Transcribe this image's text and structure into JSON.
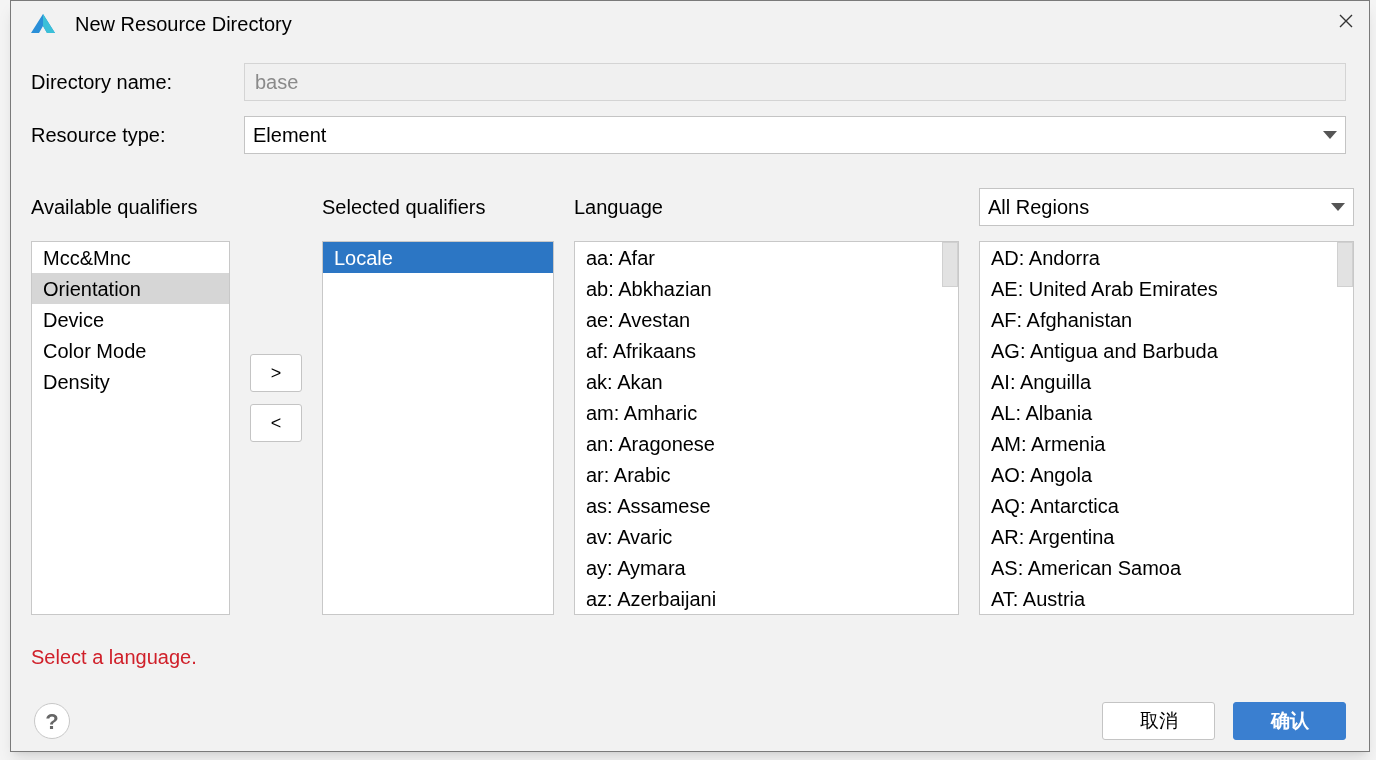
{
  "window": {
    "title": "New Resource Directory"
  },
  "directory_name": {
    "label": "Directory name:",
    "value": "base",
    "disabled": true
  },
  "resource_type": {
    "label": "Resource type:",
    "value": "Element"
  },
  "available_qualifiers": {
    "heading": "Available qualifiers",
    "items": [
      {
        "label": "Mcc&Mnc",
        "selected": false
      },
      {
        "label": "Orientation",
        "selected": true
      },
      {
        "label": "Device",
        "selected": false
      },
      {
        "label": "Color Mode",
        "selected": false
      },
      {
        "label": "Density",
        "selected": false
      }
    ]
  },
  "move_buttons": [
    {
      "label": ">"
    },
    {
      "label": "<"
    }
  ],
  "selected_qualifiers": {
    "heading": "Selected qualifiers",
    "items": [
      {
        "label": "Locale",
        "selected": true
      }
    ]
  },
  "language": {
    "heading": "Language",
    "items": [
      {
        "label": "aa: Afar",
        "selected": false
      },
      {
        "label": "ab: Abkhazian",
        "selected": false
      },
      {
        "label": "ae: Avestan",
        "selected": false
      },
      {
        "label": "af: Afrikaans",
        "selected": false
      },
      {
        "label": "ak: Akan",
        "selected": false
      },
      {
        "label": "am: Amharic",
        "selected": false
      },
      {
        "label": "an: Aragonese",
        "selected": false
      },
      {
        "label": "ar: Arabic",
        "selected": false
      },
      {
        "label": "as: Assamese",
        "selected": false
      },
      {
        "label": "av: Avaric",
        "selected": false
      },
      {
        "label": "ay: Aymara",
        "selected": false
      },
      {
        "label": "az: Azerbaijani",
        "selected": false
      }
    ]
  },
  "regions": {
    "filter": "All Regions",
    "items": [
      {
        "label": "AD: Andorra",
        "selected": false
      },
      {
        "label": "AE: United Arab Emirates",
        "selected": false
      },
      {
        "label": "AF: Afghanistan",
        "selected": false
      },
      {
        "label": "AG: Antigua and Barbuda",
        "selected": false
      },
      {
        "label": "AI: Anguilla",
        "selected": false
      },
      {
        "label": "AL: Albania",
        "selected": false
      },
      {
        "label": "AM: Armenia",
        "selected": false
      },
      {
        "label": "AO: Angola",
        "selected": false
      },
      {
        "label": "AQ: Antarctica",
        "selected": false
      },
      {
        "label": "AR: Argentina",
        "selected": false
      },
      {
        "label": "AS: American Samoa",
        "selected": false
      },
      {
        "label": "AT: Austria",
        "selected": false
      }
    ]
  },
  "error": "Select a language.",
  "help": "?",
  "buttons": [
    {
      "label": "取消",
      "kind": "secondary"
    },
    {
      "label": "确认",
      "kind": "primary"
    }
  ]
}
